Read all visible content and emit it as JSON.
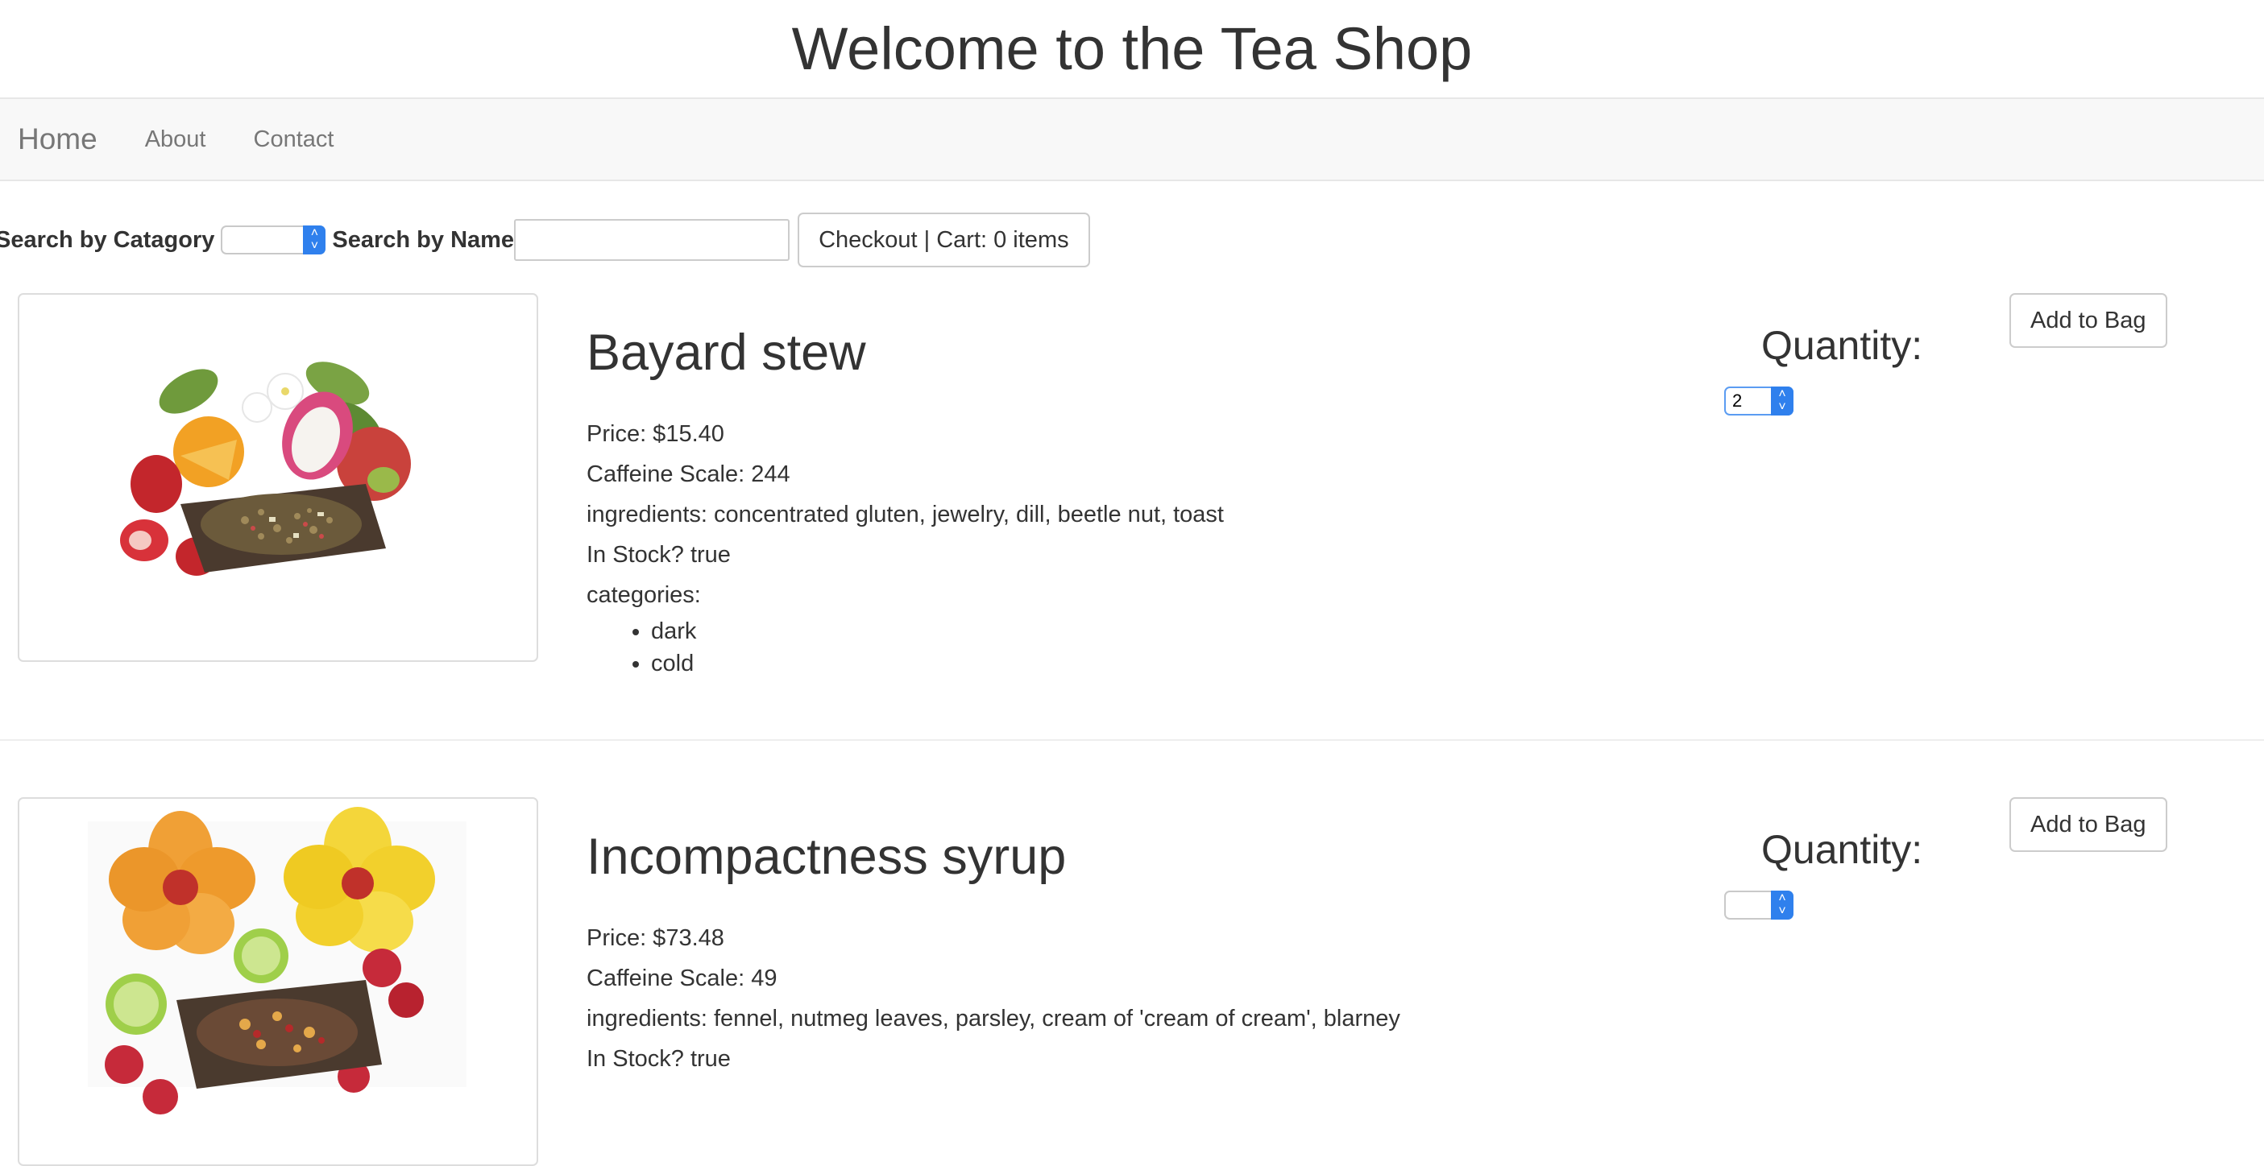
{
  "header": {
    "title": "Welcome to the Tea Shop"
  },
  "nav": {
    "home": "Home",
    "about": "About",
    "contact": "Contact"
  },
  "search": {
    "category_label": "Search by Catagory",
    "category_value": "",
    "name_label": "Search by Name",
    "name_value": "",
    "checkout_label": "Checkout | Cart: 0 items"
  },
  "products": [
    {
      "name": "Bayard stew",
      "price": "Price: $15.40",
      "caffeine": "Caffeine Scale: 244",
      "ingredients": "ingredients: concentrated gluten, jewelry, dill, beetle nut, toast",
      "in_stock": "In Stock? true",
      "categories_label": "categories:",
      "categories": [
        "dark",
        "cold"
      ],
      "quantity_label": "Quantity:",
      "quantity_value": "2",
      "add_label": "Add to Bag",
      "image": "tea blend with dragon fruit, orange, strawberries and jasmine"
    },
    {
      "name": "Incompactness syrup",
      "price": "Price: $73.48",
      "caffeine": "Caffeine Scale: 49",
      "ingredients": "ingredients: fennel, nutmeg leaves, parsley, cream of 'cream of cream', blarney",
      "in_stock": "In Stock? true",
      "quantity_label": "Quantity:",
      "quantity_value": "",
      "add_label": "Add to Bag",
      "image": "tea blend with hibiscus flowers, lime and raspberries"
    }
  ],
  "colors": {
    "select_accent": "#2f80ed",
    "navbar_bg": "#f8f8f8",
    "text": "#333333",
    "nav_text": "#777777"
  },
  "icons": {
    "select_arrow": "chevron-up-down-icon"
  }
}
